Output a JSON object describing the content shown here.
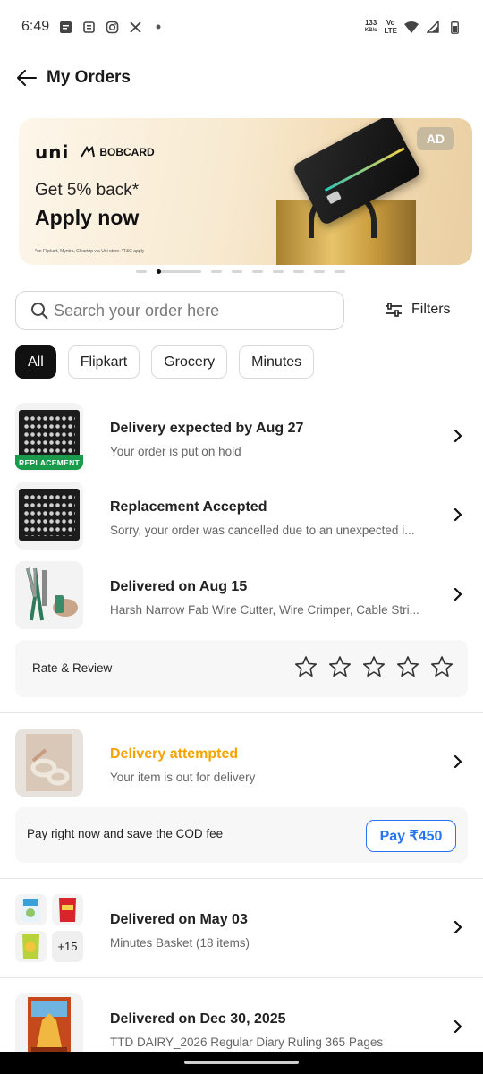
{
  "status_bar": {
    "time": "6:49",
    "net_speed_value": "133",
    "net_speed_unit": "KB/s",
    "volte": "Vo",
    "lte": "LTE"
  },
  "header": {
    "title": "My Orders"
  },
  "banner": {
    "brand": "uni",
    "partner": "BOBCARD",
    "offer": "Get 5% back*",
    "cta": "Apply now",
    "fine_print": "*on Flipkart, Myntra, Cleartrip via Uni store. *T&C apply",
    "ad_label": "AD"
  },
  "search": {
    "placeholder": "Search your order here"
  },
  "filters_label": "Filters",
  "chips": [
    {
      "label": "All",
      "selected": true
    },
    {
      "label": "Flipkart",
      "selected": false
    },
    {
      "label": "Grocery",
      "selected": false
    },
    {
      "label": "Minutes",
      "selected": false
    }
  ],
  "orders": [
    {
      "title": "Delivery expected by Aug 27",
      "subtitle": "Your order is put on hold",
      "tag": "REPLACEMENT"
    },
    {
      "title": "Replacement Accepted",
      "subtitle": "Sorry, your order was cancelled due to an unexpected i..."
    },
    {
      "title": "Delivered on Aug 15",
      "subtitle": "Harsh Narrow Fab Wire Cutter, Wire Crimper, Cable Stri..."
    },
    {
      "title": "Delivery attempted",
      "subtitle": "Your item is out for delivery"
    },
    {
      "title": "Delivered on May 03",
      "subtitle": "Minutes Basket (18 items)",
      "more_count": "+15"
    },
    {
      "title": "Delivered on Dec 30, 2025",
      "subtitle": "TTD DAIRY_2026 Regular Diary Ruling 365 Pages"
    }
  ],
  "rate_review": {
    "label": "Rate & Review",
    "stars": 5
  },
  "cod": {
    "label": "Pay right now and save the COD fee",
    "button": "Pay ₹450"
  },
  "colors": {
    "accent_blue": "#2874f0",
    "warning_orange": "#f5a300",
    "replacement_green": "#1a9b4c"
  }
}
